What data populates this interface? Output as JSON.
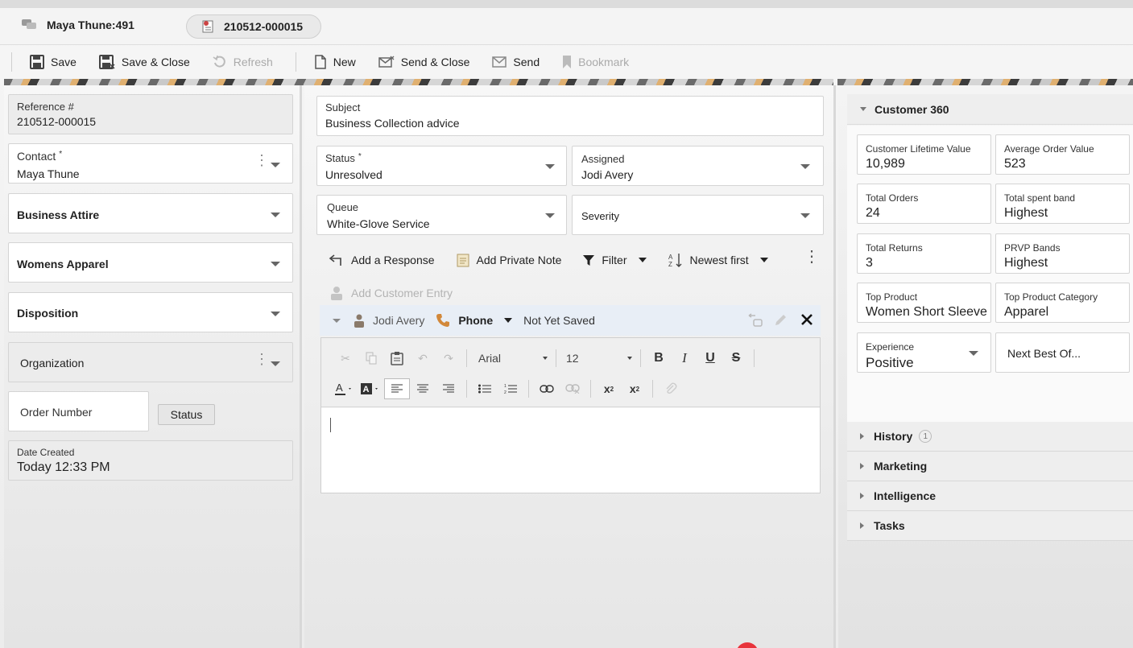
{
  "tabs": {
    "user_tab": "Maya Thune:491",
    "case_tab": "210512-000015"
  },
  "toolbar": {
    "save": "Save",
    "save_close": "Save & Close",
    "refresh": "Refresh",
    "new": "New",
    "send_close": "Send & Close",
    "send": "Send",
    "bookmark": "Bookmark"
  },
  "left": {
    "reference_label": "Reference #",
    "reference_value": "210512-000015",
    "contact_label": "Contact",
    "contact_required": "*",
    "contact_value": "Maya Thune",
    "product": "Business Attire",
    "category": "Womens Apparel",
    "disposition": "Disposition",
    "organization": "Organization",
    "order_number_placeholder": "Order Number",
    "status_button": "Status",
    "date_created_label": "Date Created",
    "date_created_value": "Today 12:33 PM"
  },
  "middle": {
    "subject_label": "Subject",
    "subject_value": "Business Collection advice",
    "status_label": "Status",
    "status_required": "*",
    "status_value": "Unresolved",
    "assigned_label": "Assigned",
    "assigned_value": "Jodi Avery",
    "queue_label": "Queue",
    "queue_value": "White-Glove Service",
    "severity_label": "Severity",
    "actions": {
      "add_response": "Add a Response",
      "add_private_note": "Add Private Note",
      "filter": "Filter",
      "sort": "Newest first"
    },
    "add_customer_entry": "Add Customer Entry",
    "entry": {
      "author": "Jodi Avery",
      "channel": "Phone",
      "state": "Not Yet Saved"
    },
    "editor": {
      "font": "Arial",
      "size": "12"
    }
  },
  "right": {
    "c360_title": "Customer 360",
    "cards": [
      {
        "label": "Customer Lifetime Value",
        "value": "10,989"
      },
      {
        "label": "Average Order Value",
        "value": "523"
      },
      {
        "label": "Total Orders",
        "value": "24"
      },
      {
        "label": "Total spent band",
        "value": "Highest"
      },
      {
        "label": "Total Returns",
        "value": "3"
      },
      {
        "label": "PRVP Bands",
        "value": "Highest"
      },
      {
        "label": "Top Product",
        "value": "Women Short Sleeve"
      },
      {
        "label": "Top Product Category",
        "value": "Apparel"
      }
    ],
    "experience_label": "Experience",
    "experience_value": "Positive",
    "next_best_offer": "Next Best Of...",
    "accordions": {
      "history": "History",
      "history_count": "1",
      "marketing": "Marketing",
      "intelligence": "Intelligence",
      "tasks": "Tasks"
    }
  }
}
